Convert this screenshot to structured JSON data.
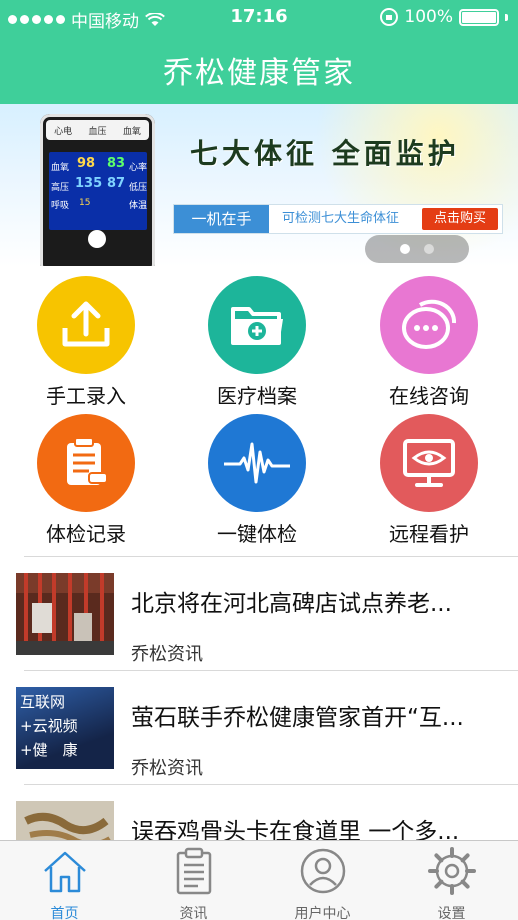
{
  "status_bar": {
    "carrier": "中国移动",
    "time": "17:16",
    "battery": "100%"
  },
  "nav": {
    "title": "乔松健康管家"
  },
  "banner": {
    "device_labels": [
      "心电",
      "血压",
      "血氧"
    ],
    "screen_values": [
      "98",
      "83",
      "135",
      "87",
      "15"
    ],
    "screen_labels": [
      "血氧",
      "心率",
      "高压",
      "低压",
      "呼吸",
      "体温"
    ],
    "slogan": "七大体征 全面监护",
    "pill_left": "一机在手",
    "pill_mid": "可检测七大生命体征",
    "pill_btn": "点击购买",
    "page_count": 2,
    "page_active": 0
  },
  "features": [
    {
      "label": "手工录入",
      "icon": "upload-icon",
      "color": "#f7c400"
    },
    {
      "label": "医疗档案",
      "icon": "medical-folder-icon",
      "color": "#1db59a"
    },
    {
      "label": "在线咨询",
      "icon": "chat-bubbles-icon",
      "color": "#e877d2"
    },
    {
      "label": "体检记录",
      "icon": "clipboard-icon",
      "color": "#f26a12"
    },
    {
      "label": "一键体检",
      "icon": "heartbeat-icon",
      "color": "#1f78d4"
    },
    {
      "label": "远程看护",
      "icon": "monitor-eye-icon",
      "color": "#e25a5c"
    }
  ],
  "news": [
    {
      "title": "北京将在河北高碑店试点养老...",
      "source": "乔松资讯"
    },
    {
      "title": "萤石联手乔松健康管家首开“互...",
      "source": "乔松资讯"
    },
    {
      "title": "误吞鸡骨头卡在食道里 一个多...",
      "source": ""
    }
  ],
  "news_thumb2_text": [
    "互联网",
    "+云视频",
    "+健　康"
  ],
  "tabs": [
    {
      "label": "首页",
      "icon": "home-icon"
    },
    {
      "label": "资讯",
      "icon": "clipboard-news-icon"
    },
    {
      "label": "用户中心",
      "icon": "user-icon"
    },
    {
      "label": "设置",
      "icon": "gear-icon"
    }
  ],
  "colors": {
    "brand": "#3fcf9a",
    "tab_active": "#2c8bd8"
  }
}
